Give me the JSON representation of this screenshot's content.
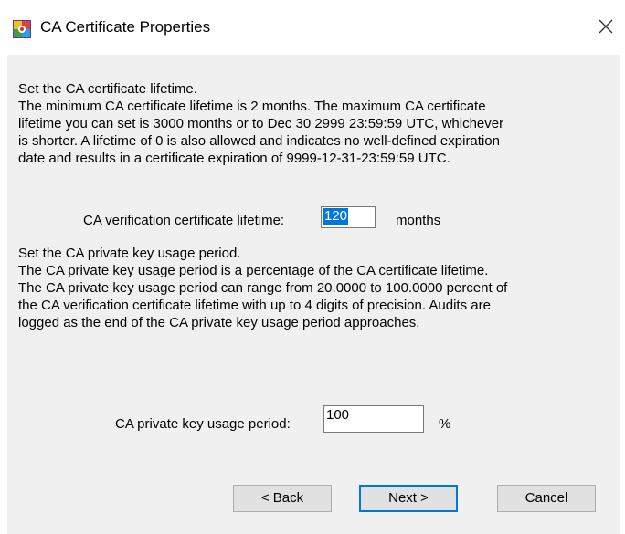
{
  "window": {
    "title": "CA Certificate Properties",
    "app_icon": "certificate-app-icon",
    "close_icon": "close-icon"
  },
  "lifetime_section": {
    "lines": [
      "Set the CA certificate lifetime.",
      "The minimum CA certificate lifetime is 2 months. The maximum CA certificate",
      "lifetime you can set is 3000 months or to Dec 30 2999 23:59:59 UTC, whichever",
      "is shorter. A lifetime of 0 is also allowed and indicates no well-defined expiration",
      "date and results in a certificate expiration of 9999-12-31-23:59:59 UTC."
    ],
    "field_label": "CA verification certificate lifetime:",
    "field_value": "120",
    "field_value_selected": true,
    "unit": "months"
  },
  "usage_section": {
    "lines": [
      "Set the CA private key usage period.",
      "The CA private key usage period is a percentage of the CA certificate lifetime.",
      "The CA private key usage period can range from 20.0000 to 100.0000 percent of",
      "the CA verification certificate lifetime with up to 4 digits of precision. Audits are",
      "logged as the end of the CA private key usage period approaches."
    ],
    "field_label": "CA private key usage period:",
    "field_value": "100",
    "unit": "%"
  },
  "buttons": {
    "back": "< Back",
    "next": "Next >",
    "cancel": "Cancel"
  },
  "colors": {
    "client_background": "#f0f0f0",
    "selection": "#0078d7",
    "default_button_border": "#0078d7"
  }
}
